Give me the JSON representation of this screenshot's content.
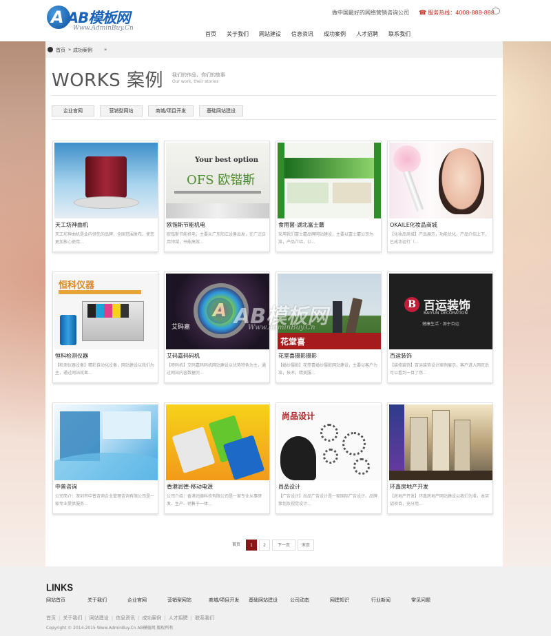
{
  "header": {
    "logo_text": "AB模板网",
    "logo_sub": "Www.AdminBuy.Cn",
    "tagline": "做中国最好的网络营销咨询公司",
    "hotline_label": "服务热线：",
    "hotline_number": "4008-888-888",
    "nav": [
      "首页",
      "关于我们",
      "网站建设",
      "信息资讯",
      "成功案例",
      "人才招聘",
      "联系我们"
    ]
  },
  "breadcrumb": {
    "home": "首页",
    "separator": "»",
    "current": "成功案例"
  },
  "page": {
    "title": "WORKS 案例",
    "subtitle_cn": "我们的作品，你们的故事",
    "subtitle_en": "Our work, their stories"
  },
  "categories": [
    "企业官网",
    "营销型网站",
    "商城/项目开发",
    "基础网站建设"
  ],
  "cards": [
    {
      "title": "天工坊神曲机",
      "desc": "天工坊神曲机是业内领先的品牌，全国范围发布，使您更加放心使用..."
    },
    {
      "title": "欧锴斯节能机电",
      "desc": "欧锴斯节能机电，主要从广东阳江设备出发，在广泛应用领域，节能高效..."
    },
    {
      "title": "食用菌-湖北富士蘑",
      "desc": "采用我们富士蘑品牌网站建设，主要以富士蘑公司为准，产品介绍，公..."
    },
    {
      "title": "OKAILE化妆品商城",
      "desc": "【化妆品商城】产品展示，功能优化，产品介绍上下，已成功运行（..."
    },
    {
      "title": "恒科检测仪器",
      "desc": "【检测仪器设备】精彩自动化设备，网站建设以我们为主，通过网站效果..."
    },
    {
      "title": "艾码嘉码码机",
      "desc": "【喷码机】艾码嘉码码机网站建设以优势特色为主，通过网站内容数据完..."
    },
    {
      "title": "花堂喜摄影摄影",
      "desc": "【婚纱摄影】花堂喜婚纱摄影网站建设，主要以客户为准，技术，精美服..."
    },
    {
      "title": "百运装饰",
      "desc": "【装修装饰】百运装饰设计案例展示，客户进入网页后可以看到一目了然..."
    },
    {
      "title": "中普咨询",
      "desc": "公司简介：深圳市中普咨询企业管理咨询有限公司是一家专业提供服务..."
    },
    {
      "title": "香港润德-移动电源",
      "desc": "公司介绍：香港润德科技有限公司是一家专业从事研发、生产、销售于一体..."
    },
    {
      "title": "尚品设计",
      "desc": "【广告设计】尚品广告设计是一家国际广告设计、品牌策划及视觉设计..."
    },
    {
      "title": "环鑫房地产开发",
      "desc": "【房地产开发】环鑫房地产网站建设以我们为准，本实战项目，充分用..."
    }
  ],
  "watermark": {
    "text": "AB模板网",
    "sub": "Www.AdminBuy.Cn"
  },
  "pagination": {
    "first": "首页",
    "pages": [
      "1",
      "2"
    ],
    "active": "1",
    "next": "下一页",
    "last": "末页"
  },
  "footer": {
    "links_title": "LINKS",
    "links": [
      "网站首页",
      "关于我们",
      "企业官网",
      "营销型网站",
      "商城/项目开发",
      "基础网站建设",
      "公司动态",
      "网建知识",
      "行业新闻",
      "常见问题"
    ],
    "nav": [
      "首页",
      "关于我们",
      "网站建设",
      "信息资讯",
      "成功案例",
      "人才招聘",
      "联系我们"
    ],
    "copyright": "Copyright © 2014-2015 Www.AdminBuy.Cn AB模板网 版权所有"
  },
  "colors": {
    "brand_blue": "#1a63b8",
    "accent_red": "#8b1414",
    "hotline_red": "#c8281e"
  }
}
